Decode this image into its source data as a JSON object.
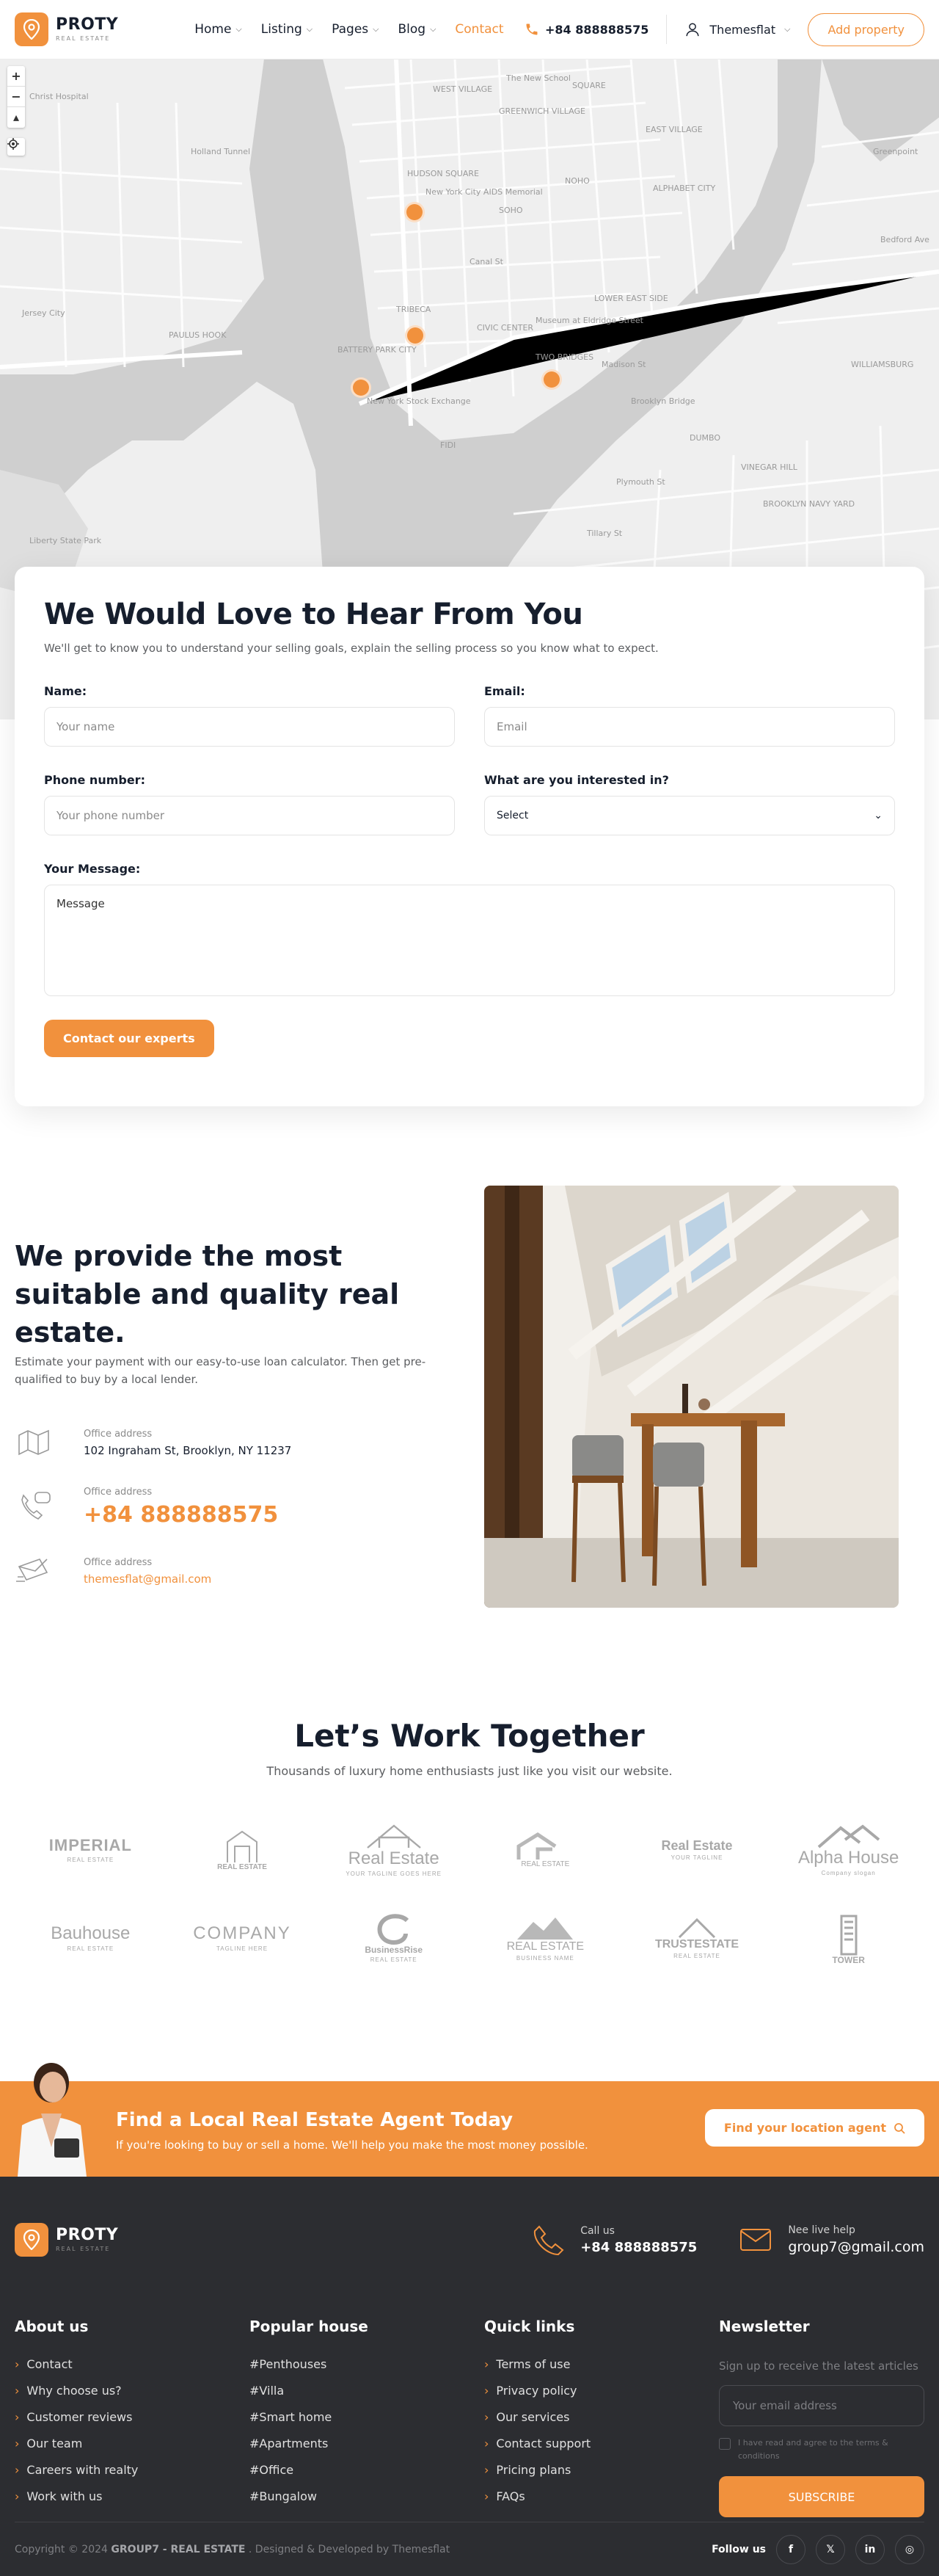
{
  "header": {
    "logo_name": "PROTY",
    "logo_sub": "REAL ESTATE",
    "nav": [
      {
        "label": "Home",
        "dropdown": true
      },
      {
        "label": "Listing",
        "dropdown": true
      },
      {
        "label": "Pages",
        "dropdown": true
      },
      {
        "label": "Blog",
        "dropdown": true
      },
      {
        "label": "Contact",
        "dropdown": false,
        "active": true
      }
    ],
    "phone": "+84 888888575",
    "user": "Themesflat",
    "add_property": "Add property"
  },
  "map": {
    "labels": [
      "Christ Hospital",
      "The New School",
      "GREENWICH VILLAGE",
      "WEST VILLAGE",
      "SQUARE",
      "EAST VILLAGE",
      "New York City AIDS Memorial",
      "HUDSON SQUARE",
      "ALPHABET CITY",
      "NOHO",
      "SOHO",
      "Holland Tunnel",
      "LOWER EAST SIDE",
      "TRIBECA",
      "CIVIC CENTER",
      "Museum at Eldridge Street",
      "TWO BRIDGES",
      "Jersey City",
      "PAULUS HOOK",
      "BATTERY PARK CITY",
      "New York Stock Exchange",
      "FIDI",
      "Brooklyn Bridge",
      "DUMBO",
      "VINEGAR HILL",
      "WILLIAMSBURG",
      "BROOKLYN NAVY YARD",
      "Plymouth St",
      "Tillary St",
      "Liberty State Park",
      "Greenpoint",
      "Bedford Ave",
      "Canal St",
      "Madison St"
    ],
    "zoom_in": "+",
    "zoom_out": "−",
    "reset": "▴"
  },
  "contact": {
    "title": "We Would Love to Hear From You",
    "lead": "We'll get to know you to understand your selling goals, explain the selling process so you know what to expect.",
    "name_label": "Name:",
    "name_placeholder": "Your name",
    "email_label": "Email:",
    "email_placeholder": "Email",
    "phone_label": "Phone number:",
    "phone_placeholder": "Your phone number",
    "interest_label": "What are you interested in?",
    "interest_value": "Select",
    "message_label": "Your Message:",
    "message_placeholder": "Message",
    "submit": "Contact our experts"
  },
  "about": {
    "title": "We provide the most suitable and quality real estate.",
    "desc": "Estimate your payment with our easy-to-use loan calculator. Then get pre-qualified to buy by a local lender.",
    "items": [
      {
        "label": "Office address",
        "value": "102 Ingraham St, Brooklyn, NY 11237"
      },
      {
        "label": "Office address",
        "value": "+84 888888575"
      },
      {
        "label": "Office address",
        "value": "themesflat@gmail.com"
      }
    ]
  },
  "partners": {
    "title": "Let’s Work Together",
    "sub": "Thousands of luxury home enthusiasts just like you visit our website.",
    "logos": [
      {
        "text": "IMPERIAL",
        "sub": "REAL ESTATE"
      },
      {
        "text": "REAL ESTATE",
        "sub": ""
      },
      {
        "text": "Real Estate",
        "sub": "YOUR TAGLINE GOES HERE"
      },
      {
        "text": "REAL ESTATE",
        "sub": ""
      },
      {
        "text": "Real Estate",
        "sub": "YOUR TAGLINE"
      },
      {
        "text": "Alpha House",
        "sub": "Company slogan"
      },
      {
        "text": "Bauhouse",
        "sub": "REAL ESTATE"
      },
      {
        "text": "COMPANY",
        "sub": "TAGLINE HERE"
      },
      {
        "text": "BusinessRise",
        "sub": "REAL ESTATE"
      },
      {
        "text": "REAL ESTATE",
        "sub": "BUSINESS NAME"
      },
      {
        "text": "TRUSTESTATE",
        "sub": "REAL ESTATE"
      },
      {
        "text": "TOWER",
        "sub": ""
      }
    ]
  },
  "banner": {
    "title": "Find a Local Real Estate Agent Today",
    "text": "If you're looking to buy or sell a home. We'll help you make the most money possible.",
    "button": "Find your location agent"
  },
  "footer": {
    "logo_name": "PROTY",
    "logo_sub": "REAL ESTATE",
    "call_label": "Call us",
    "call_value": "+84 888888575",
    "help_label": "Nee live help",
    "help_value": "group7@gmail.com",
    "about_title": "About us",
    "about_links": [
      "Contact",
      "Why choose us?",
      "Customer reviews",
      "Our team",
      "Careers with realty",
      "Work with us"
    ],
    "popular_title": "Popular house",
    "popular_links": [
      "#Penthouses",
      "#Villa",
      "#Smart home",
      "#Apartments",
      "#Office",
      "#Bungalow"
    ],
    "quick_title": "Quick links",
    "quick_links": [
      "Terms of use",
      "Privacy policy",
      "Our services",
      "Contact support",
      "Pricing plans",
      "FAQs"
    ],
    "newsletter_title": "Newsletter",
    "newsletter_text": "Sign up to receive the latest articles",
    "email_placeholder": "Your email address",
    "agree_text": "I have read and agree to the terms & conditions",
    "subscribe": "SUBSCRIBE",
    "copyright_pre": "Copyright © 2024 ",
    "copyright_brand": "GROUP7 - REAL ESTATE",
    "copyright_post": " . Designed & Developed by Themesflat",
    "follow": "Follow us",
    "socials": [
      "f",
      "𝕏",
      "in",
      "◎"
    ]
  },
  "colors": {
    "accent": "#f1913d",
    "dark": "#2c2d31",
    "text": "#161e2d"
  }
}
